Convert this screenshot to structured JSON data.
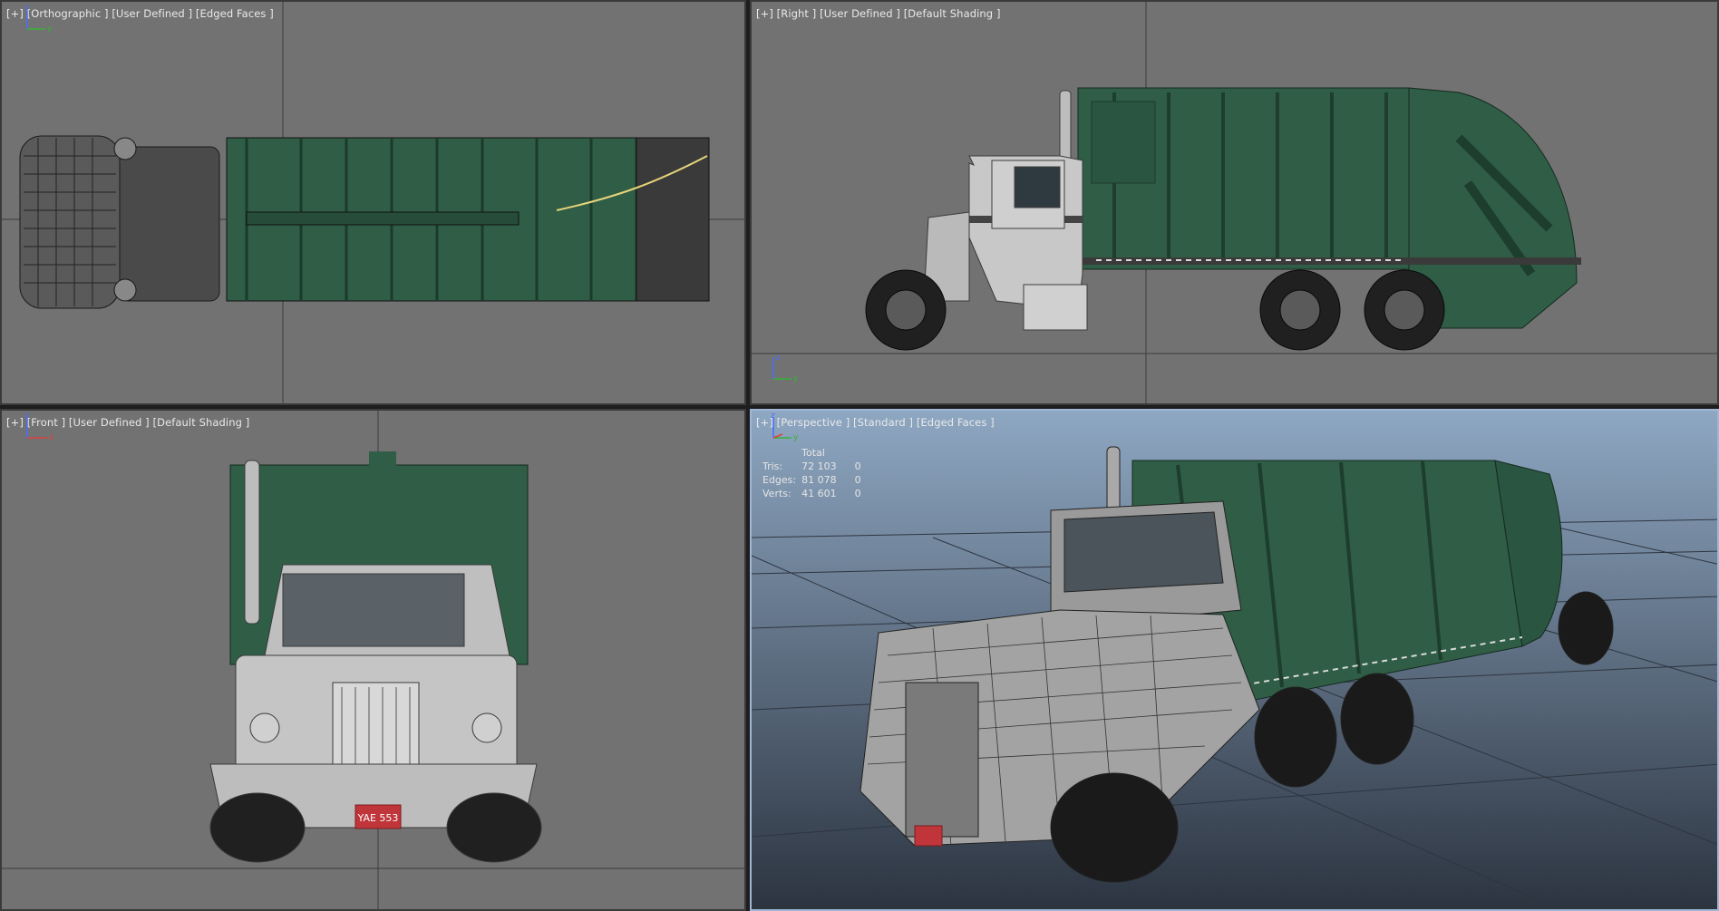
{
  "viewports": {
    "top": {
      "label": "[+] [Orthographic ] [User Defined ] [Edged Faces ]"
    },
    "right": {
      "label": "[+] [Right ] [User Defined ] [Default Shading ]"
    },
    "front": {
      "label": "[+] [Front ] [User Defined ] [Default Shading ]"
    },
    "perspective": {
      "label": "[+] [Perspective ] [Standard ] [Edged Faces ]"
    }
  },
  "stats": {
    "header": "Total",
    "rows": [
      {
        "name": "Tris:",
        "total": "72 103",
        "sel": "0"
      },
      {
        "name": "Edges:",
        "total": "81 078",
        "sel": "0"
      },
      {
        "name": "Verts:",
        "total": "41 601",
        "sel": "0"
      }
    ]
  },
  "plate": "YAE 553",
  "colors": {
    "viewport_bg": "#727272",
    "truck_green": "#2f5d45",
    "cab_gray": "#c8c8c8",
    "active_border": "#9fb6d4",
    "perspective_top": "#8ea7c2",
    "perspective_bottom": "#2c3440"
  },
  "axis_labels": {
    "top": [
      "z",
      "y",
      "x"
    ],
    "right": [
      "z",
      "y"
    ],
    "front": [
      "z",
      "x"
    ],
    "perspective": [
      "z",
      "x",
      "y"
    ]
  }
}
